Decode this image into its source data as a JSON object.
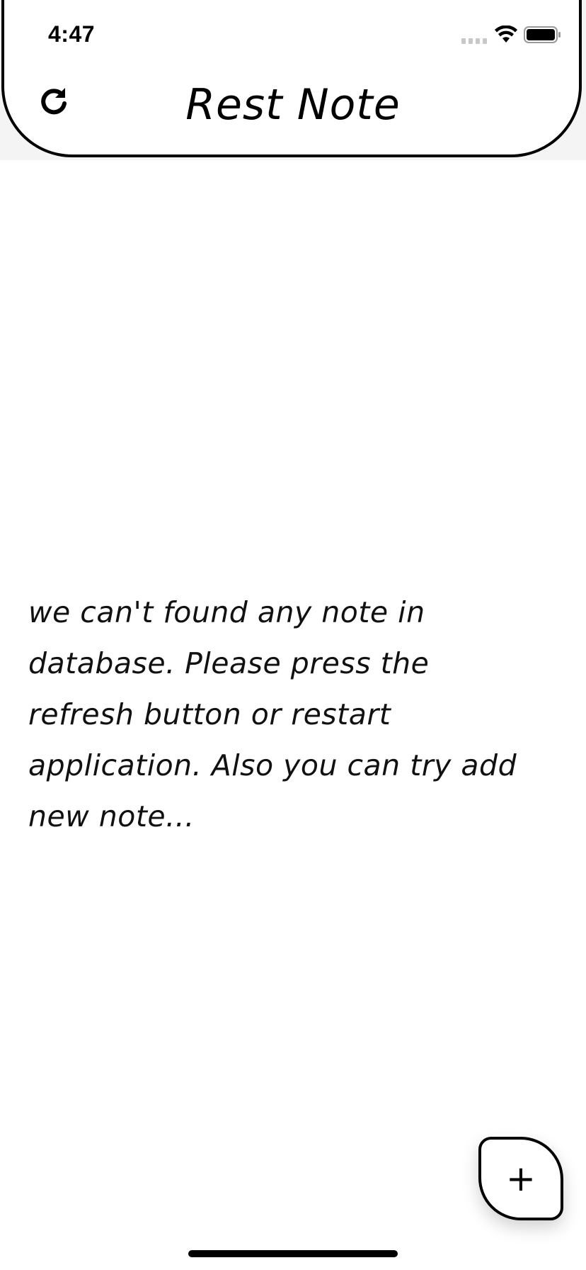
{
  "status_bar": {
    "time": "4:47",
    "signal_icon": "signal-bars-icon",
    "wifi_icon": "wifi-icon",
    "battery_icon": "battery-icon"
  },
  "app_bar": {
    "title": "Rest Note",
    "refresh_icon": "refresh-icon"
  },
  "main": {
    "empty_message": "we can't found any note in database. Please press the refresh button or restart application. Also you can try add new note..."
  },
  "fab": {
    "label": "+"
  },
  "colors": {
    "background": "#ffffff",
    "header_band": "#f4f4f4",
    "outline": "#000000",
    "text": "#111111"
  }
}
